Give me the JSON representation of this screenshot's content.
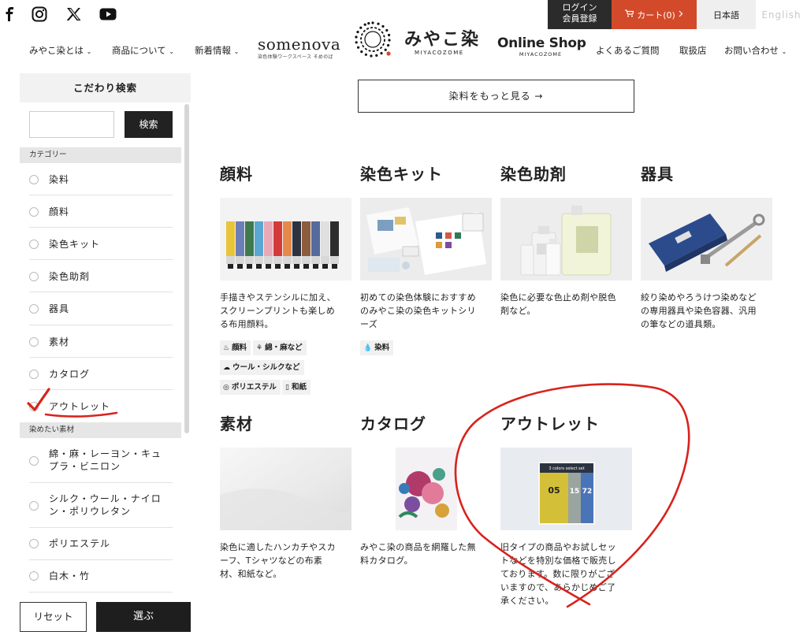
{
  "header": {
    "social": [
      "facebook-icon",
      "instagram-icon",
      "x-icon",
      "youtube-icon"
    ],
    "login_line1": "ログイン",
    "login_line2": "会員登録",
    "cart_label": "カート(0)",
    "lang_ja": "日本語",
    "lang_en": "English",
    "nav_left": [
      "みやこ染とは",
      "商品について",
      "新着情報"
    ],
    "nav_right": [
      "よくあるご質問",
      "取扱店",
      "お問い合わせ"
    ],
    "somenova_big": "somenova",
    "somenova_small": "染色体験ワークスペース そめのば",
    "miya_jp": "みやこ染",
    "miya_en": "MIYACOZOME",
    "shop_big": "Online Shop",
    "shop_small": "MIYACOZOME"
  },
  "sidebar": {
    "title": "こだわり検索",
    "search_value": "",
    "search_button": "検索",
    "section_category": "カテゴリー",
    "categories": [
      "染料",
      "顔料",
      "染色キット",
      "染色助剤",
      "器具",
      "素材",
      "カタログ",
      "アウトレット"
    ],
    "section_material": "染めたい素材",
    "materials": [
      {
        "line1": "綿・麻・レーヨン・キュ",
        "line2": "プラ・ビニロン"
      },
      {
        "line1": "シルク・ウール・ナイロ",
        "line2": "ン・ポリウレタン"
      },
      {
        "line1": "ポリエステル",
        "line2": ""
      },
      {
        "line1": "白木・竹",
        "line2": ""
      }
    ],
    "reset_button": "リセット",
    "choose_button": "選ぶ"
  },
  "main": {
    "more_button": "染料をもっと見る →",
    "cards": [
      {
        "title": "顔料",
        "desc": [
          "手描きやステンシルに加え、",
          "スクリーンプリントも楽しめ",
          "る布用顔料。"
        ]
      },
      {
        "title": "染色キット",
        "desc": [
          "初めての染色体験におすすめ",
          "のみやこ染の染色キットシリ",
          "ーズ"
        ]
      },
      {
        "title": "染色助剤",
        "desc": [
          "染色に必要な色止め剤や脱色",
          "剤など。"
        ]
      },
      {
        "title": "器具",
        "desc": [
          "絞り染めやろうけつ染めなど",
          "の専用器具や染色容器、汎用",
          "の筆などの道具類。"
        ]
      },
      {
        "title": "素材",
        "desc": [
          "染色に適したハンカチやスカ",
          "ーフ、Tシャツなどの布素",
          "材、和紙など。"
        ]
      },
      {
        "title": "カタログ",
        "desc": [
          "みやこ染の商品を網羅した無",
          "料カタログ。"
        ]
      },
      {
        "title": "アウトレット",
        "desc": [
          "旧タイプの商品やお試しセッ",
          "トなどを特別な価格で販売し",
          "ております。数に限りがござ",
          "いますので、あらかじめご了",
          "承ください。"
        ]
      }
    ],
    "pigment_tags": [
      "顔料",
      "綿・麻など",
      "ウール・シルクなど",
      "ポリエステル",
      "和紙"
    ],
    "kit_tags": [
      "染料"
    ],
    "outlet_pack_label": "3 colors select set",
    "outlet_pack_numbers": [
      "05",
      "15",
      "72"
    ]
  },
  "colors": {
    "cart": "#d24a2a",
    "dark": "#222222",
    "annotation": "#d8231c"
  }
}
